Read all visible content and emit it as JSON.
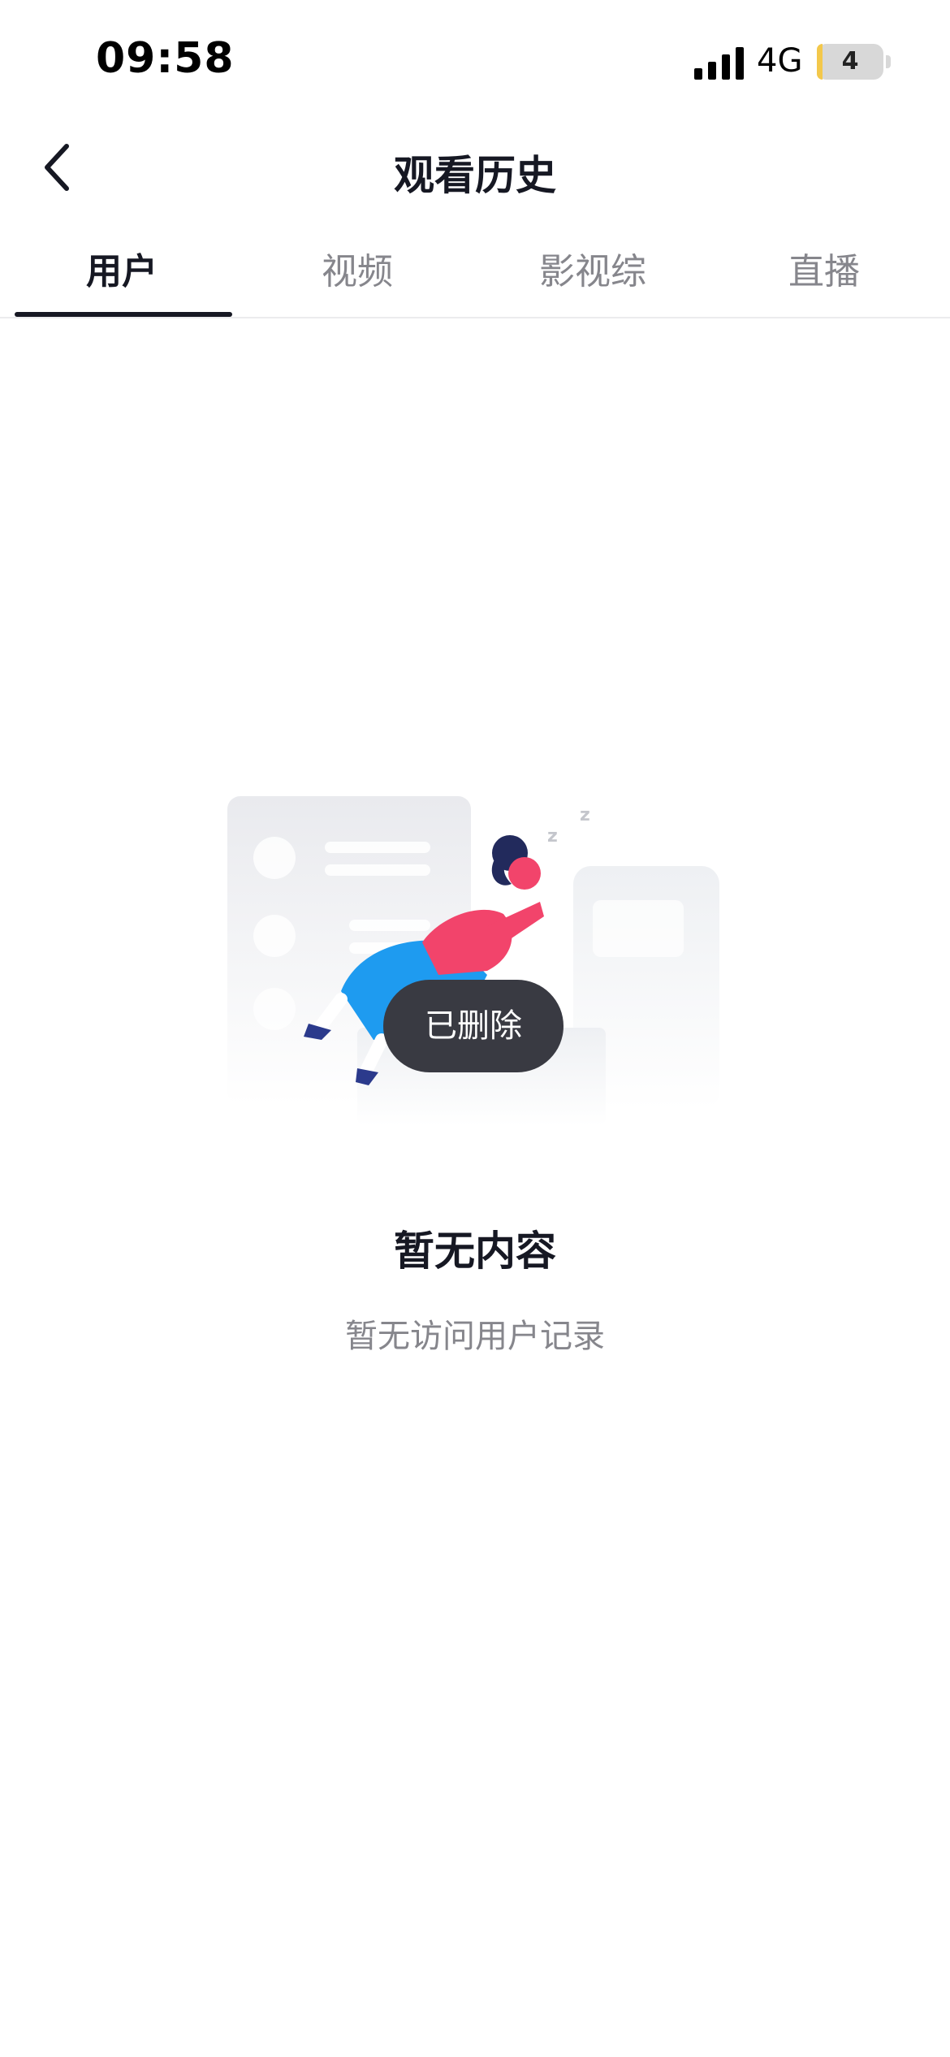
{
  "status_bar": {
    "time": "09:58",
    "network": "4G",
    "battery": "4",
    "battery_color": "#f3c84b"
  },
  "nav": {
    "back_icon": "chevron-left-icon",
    "title": "观看历史"
  },
  "tabs": [
    {
      "label": "用户",
      "active": true
    },
    {
      "label": "视频",
      "active": false
    },
    {
      "label": "影视综",
      "active": false
    },
    {
      "label": "直播",
      "active": false
    }
  ],
  "empty_state": {
    "illustration": "empty-illustration-woman-reading",
    "title": "暂无内容",
    "description": "暂无访问用户记录"
  },
  "toast": {
    "text": "已删除"
  },
  "colors": {
    "primary_text": "#161823",
    "secondary_text": "#86868c",
    "toast_bg": "#393a42",
    "accent_pink": "#f2446b",
    "accent_blue": "#1e9bf0"
  }
}
